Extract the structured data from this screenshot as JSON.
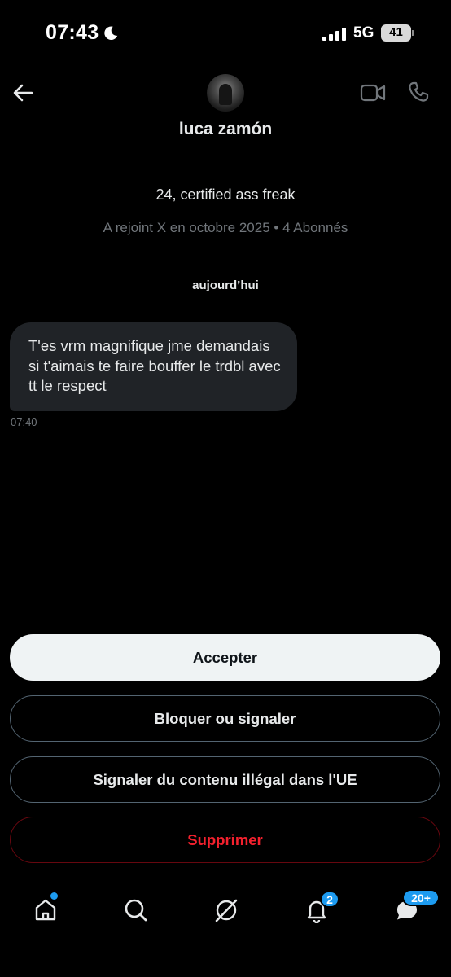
{
  "status_bar": {
    "time": "07:43",
    "network": "5G",
    "battery": "41"
  },
  "header": {
    "name": "luca zamón"
  },
  "profile": {
    "bio": "24, certified ass freak",
    "meta": "A rejoint X en octobre 2025 • 4 Abonnés"
  },
  "conversation": {
    "date_separator": "aujourd’hui",
    "messages": [
      {
        "text": "T'es vrm magnifique jme demandais si t'aimais te faire bouffer le trdbl avec tt le respect",
        "time": "07:40"
      }
    ]
  },
  "actions": {
    "accept": "Accepter",
    "block": "Bloquer ou signaler",
    "report_illegal": "Signaler du contenu illégal dans l'UE",
    "delete": "Supprimer"
  },
  "nav": {
    "items": [
      {
        "icon": "home-icon"
      },
      {
        "icon": "search-icon"
      },
      {
        "icon": "grok-icon"
      },
      {
        "icon": "bell-icon",
        "badge": "2"
      },
      {
        "icon": "messages-icon",
        "badge": "20+"
      }
    ]
  },
  "colors": {
    "background": "#000000",
    "bubble": "#202327",
    "accent": "#1d9bf0",
    "danger": "#f4212e",
    "secondary_text": "#71767b"
  }
}
